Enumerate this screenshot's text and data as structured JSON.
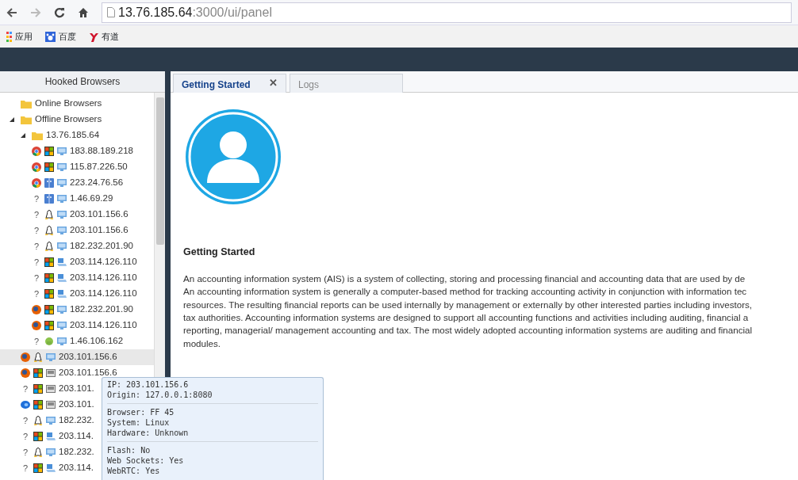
{
  "browser": {
    "address_host": "13.76.185.64",
    "address_rest": ":3000/ui/panel",
    "bookmarks": [
      {
        "label": "应用",
        "kind": "apps"
      },
      {
        "label": "百度",
        "kind": "paw"
      },
      {
        "label": "有道",
        "kind": "y"
      }
    ]
  },
  "sidebar": {
    "title": "Hooked Browsers",
    "tree": [
      {
        "kind": "folder",
        "label": "Online Browsers",
        "expanded": false
      },
      {
        "kind": "folder",
        "label": "Offline Browsers",
        "expanded": true,
        "children": [
          {
            "kind": "folder",
            "label": "13.76.185.64",
            "expanded": true,
            "children": [
              {
                "kind": "host",
                "label": "183.88.189.218",
                "icons": [
                  {
                    "kind": "chrome"
                  },
                  {
                    "kind": "windows"
                  },
                  {
                    "kind": "desktop"
                  }
                ],
                "selected": false
              },
              {
                "kind": "host",
                "label": "115.87.226.50",
                "icons": [
                  {
                    "kind": "chrome"
                  },
                  {
                    "kind": "windows"
                  },
                  {
                    "kind": "desktop"
                  }
                ],
                "selected": false
              },
              {
                "kind": "host",
                "label": "223.24.76.56",
                "icons": [
                  {
                    "kind": "chrome"
                  },
                  {
                    "kind": "mac"
                  },
                  {
                    "kind": "desktop"
                  }
                ],
                "selected": false
              },
              {
                "kind": "host",
                "label": "1.46.69.29",
                "icons": [
                  {
                    "kind": "text",
                    "text": "?"
                  },
                  {
                    "kind": "mac"
                  },
                  {
                    "kind": "desktop"
                  }
                ],
                "selected": false
              },
              {
                "kind": "host",
                "label": "203.101.156.6",
                "icons": [
                  {
                    "kind": "text",
                    "text": "?"
                  },
                  {
                    "kind": "linux"
                  },
                  {
                    "kind": "desktop"
                  }
                ],
                "selected": false
              },
              {
                "kind": "host",
                "label": "203.101.156.6",
                "icons": [
                  {
                    "kind": "text",
                    "text": "?"
                  },
                  {
                    "kind": "linux"
                  },
                  {
                    "kind": "desktop"
                  }
                ],
                "selected": false
              },
              {
                "kind": "host",
                "label": "182.232.201.90",
                "icons": [
                  {
                    "kind": "text",
                    "text": "?"
                  },
                  {
                    "kind": "linux"
                  },
                  {
                    "kind": "desktop"
                  }
                ],
                "selected": false
              },
              {
                "kind": "host",
                "label": "203.114.126.110",
                "icons": [
                  {
                    "kind": "text",
                    "text": "?"
                  },
                  {
                    "kind": "windows"
                  },
                  {
                    "kind": "laptop"
                  }
                ],
                "selected": false
              },
              {
                "kind": "host",
                "label": "203.114.126.110",
                "icons": [
                  {
                    "kind": "text",
                    "text": "?"
                  },
                  {
                    "kind": "windows"
                  },
                  {
                    "kind": "laptop"
                  }
                ],
                "selected": false
              },
              {
                "kind": "host",
                "label": "203.114.126.110",
                "icons": [
                  {
                    "kind": "text",
                    "text": "?"
                  },
                  {
                    "kind": "windows"
                  },
                  {
                    "kind": "laptop"
                  }
                ],
                "selected": false
              },
              {
                "kind": "host",
                "label": "182.232.201.90",
                "icons": [
                  {
                    "kind": "firefox"
                  },
                  {
                    "kind": "windows"
                  },
                  {
                    "kind": "desktop"
                  }
                ],
                "selected": false
              },
              {
                "kind": "host",
                "label": "203.114.126.110",
                "icons": [
                  {
                    "kind": "firefox"
                  },
                  {
                    "kind": "windows"
                  },
                  {
                    "kind": "desktop"
                  }
                ],
                "selected": false
              },
              {
                "kind": "host",
                "label": "1.46.106.162",
                "icons": [
                  {
                    "kind": "text",
                    "text": "?"
                  },
                  {
                    "kind": "android"
                  },
                  {
                    "kind": "desktop"
                  }
                ],
                "selected": false
              }
            ]
          },
          {
            "kind": "host",
            "label": "203.101.156.6",
            "icons": [
              {
                "kind": "firefox"
              },
              {
                "kind": "linux"
              },
              {
                "kind": "desktop"
              }
            ],
            "selected": true
          },
          {
            "kind": "host",
            "label": "203.101.156.6",
            "icons": [
              {
                "kind": "firefox"
              },
              {
                "kind": "windows"
              },
              {
                "kind": "vm"
              }
            ],
            "selected": false
          },
          {
            "kind": "host",
            "label": "203.101.",
            "icons": [
              {
                "kind": "text",
                "text": "?"
              },
              {
                "kind": "windows"
              },
              {
                "kind": "vm"
              }
            ],
            "selected": false
          },
          {
            "kind": "host",
            "label": "203.101.",
            "icons": [
              {
                "kind": "ie"
              },
              {
                "kind": "windows"
              },
              {
                "kind": "vm"
              }
            ],
            "selected": false
          },
          {
            "kind": "host",
            "label": "182.232.",
            "icons": [
              {
                "kind": "text",
                "text": "?"
              },
              {
                "kind": "linux"
              },
              {
                "kind": "desktop"
              }
            ],
            "selected": false
          },
          {
            "kind": "host",
            "label": "203.114.",
            "icons": [
              {
                "kind": "text",
                "text": "?"
              },
              {
                "kind": "windows"
              },
              {
                "kind": "laptop"
              }
            ],
            "selected": false
          },
          {
            "kind": "host",
            "label": "182.232.",
            "icons": [
              {
                "kind": "text",
                "text": "?"
              },
              {
                "kind": "linux"
              },
              {
                "kind": "desktop"
              }
            ],
            "selected": false
          },
          {
            "kind": "host",
            "label": "203.114.",
            "icons": [
              {
                "kind": "text",
                "text": "?"
              },
              {
                "kind": "windows"
              },
              {
                "kind": "laptop"
              }
            ],
            "selected": false
          }
        ]
      }
    ]
  },
  "tabs": [
    {
      "label": "Getting Started",
      "selected": true,
      "close": "✕"
    },
    {
      "label": "Logs",
      "selected": false
    }
  ],
  "content": {
    "heading": "Getting Started",
    "paragraph_lines": [
      "An accounting information system (AIS) is a system of collecting, storing and processing financial and accounting data that are used by de",
      "An accounting information system is generally a computer-based method for tracking accounting activity in conjunction with information tec",
      "resources. The resulting financial reports can be used internally by management or externally by other interested parties including investors,",
      "tax authorities. Accounting information systems are designed to support all accounting functions and activities including auditing, financial a",
      "reporting, managerial/ management accounting and tax. The most widely adopted accounting information systems are auditing and financial",
      "modules."
    ]
  },
  "tooltip": {
    "groups": [
      [
        "IP: 203.101.156.6",
        "Origin: 127.0.0.1:8080"
      ],
      [
        "Browser: FF 45",
        "System: Linux",
        "Hardware: Unknown"
      ],
      [
        "Flash: No",
        "Web Sockets: Yes",
        "WebRTC: Yes"
      ]
    ]
  }
}
